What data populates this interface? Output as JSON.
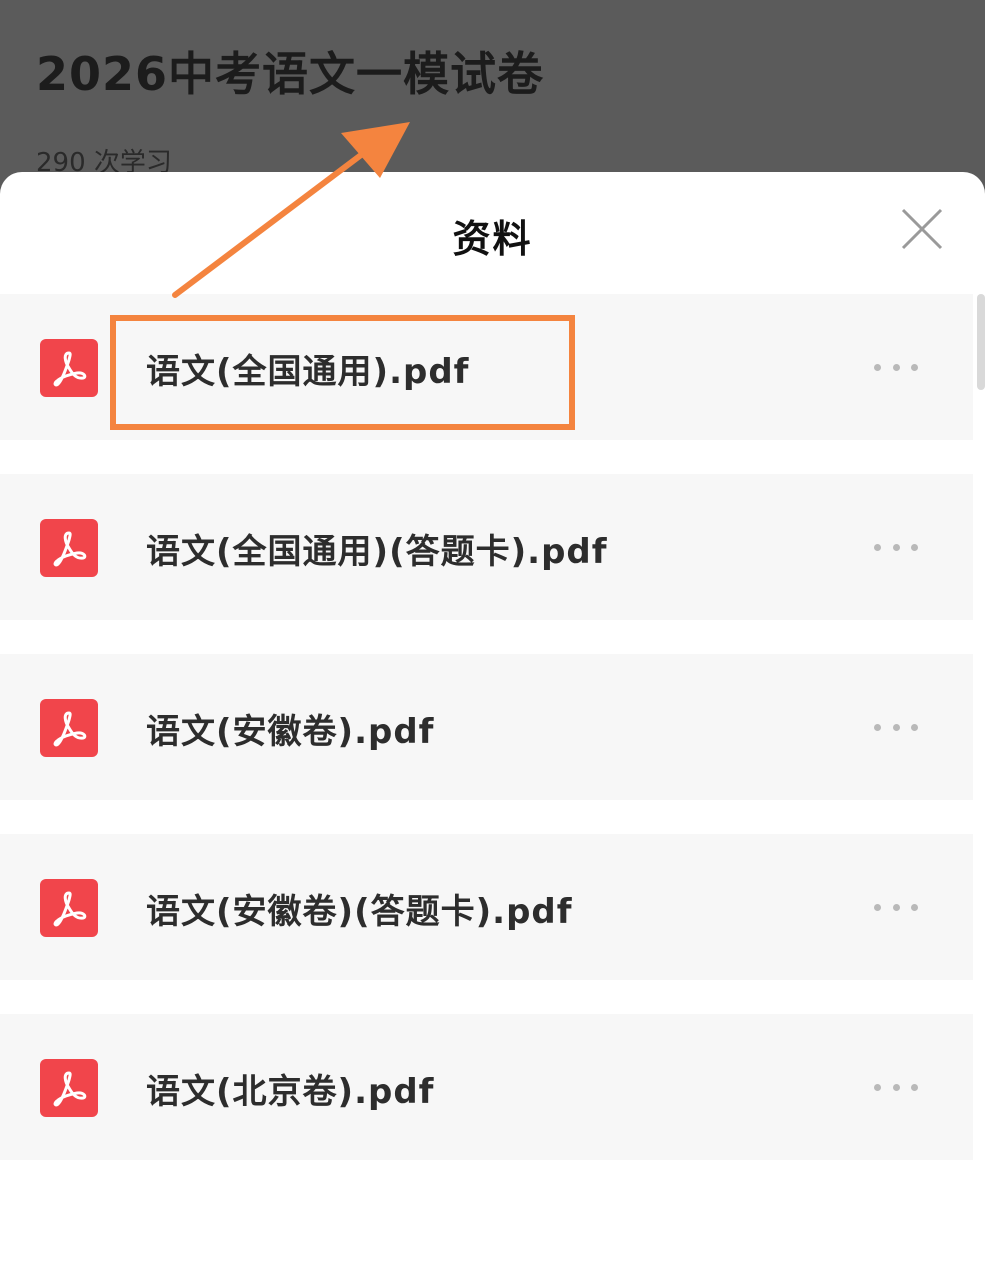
{
  "header": {
    "title": "2026中考语文一模试卷",
    "study_count": "290 次学习"
  },
  "sheet": {
    "title": "资料",
    "close_icon": "close-icon"
  },
  "files": [
    {
      "name": "语文(全国通用).pdf",
      "icon": "pdf-icon"
    },
    {
      "name": "语文(全国通用)(答题卡).pdf",
      "icon": "pdf-icon"
    },
    {
      "name": "语文(安徽卷).pdf",
      "icon": "pdf-icon"
    },
    {
      "name": "语文(安徽卷)(答题卡).pdf",
      "icon": "pdf-icon"
    },
    {
      "name": "语文(北京卷).pdf",
      "icon": "pdf-icon"
    }
  ],
  "colors": {
    "pdf_icon": "#f1454b",
    "annotation": "#f4843f",
    "overlay": "#5a5a5a"
  }
}
